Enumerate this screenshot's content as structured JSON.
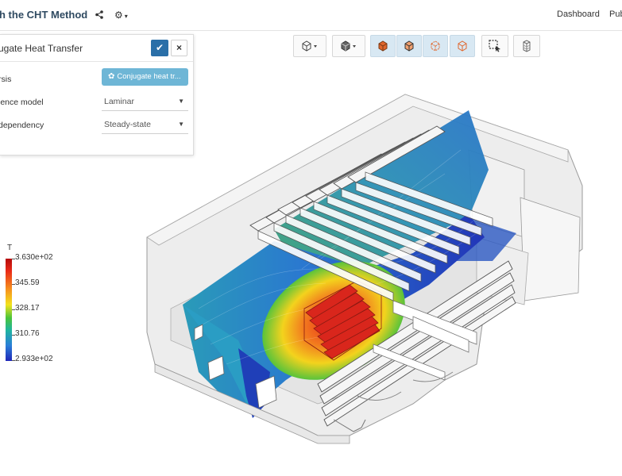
{
  "header": {
    "title": "h the CHT Method",
    "nav": {
      "dashboard": "Dashboard",
      "public": "Pub"
    }
  },
  "panel": {
    "title": "ugate Heat Transfer",
    "ok_icon": "check-icon",
    "close_symbol": "×",
    "rows": [
      {
        "label": "rsis",
        "value": "Conjugate heat tr..."
      },
      {
        "label": "lence model",
        "value": "Laminar"
      },
      {
        "label": "dependency",
        "value": "Steady-state"
      }
    ]
  },
  "legend": {
    "title": "T",
    "labels": [
      "3.630e+02",
      "345.59",
      "328.17",
      "310.76",
      "2.933e+02"
    ]
  },
  "toolbar": {
    "buttons": [
      "view-orientation",
      "render-mode",
      "solid-view",
      "surface-edges-view",
      "wireframe-view",
      "transparent-view",
      "box-select",
      "hide-parts"
    ],
    "active": "solid-view"
  },
  "colors": {
    "accent": "#2a6fa8",
    "pill": "#6eb6d6",
    "hot": "#e8281b",
    "cold": "#2027b8"
  }
}
